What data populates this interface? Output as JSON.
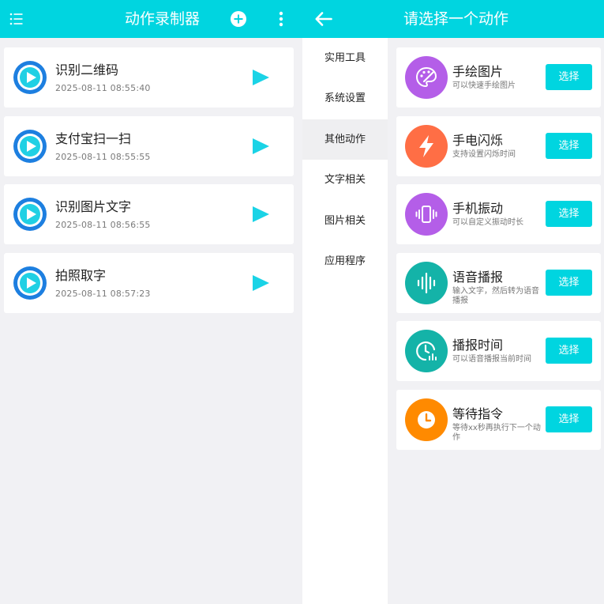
{
  "left": {
    "title": "动作录制器",
    "records": [
      {
        "title": "识别二维码",
        "time": "2025-08-11 08:55:40"
      },
      {
        "title": "支付宝扫一扫",
        "time": "2025-08-11 08:55:55"
      },
      {
        "title": "识别图片文字",
        "time": "2025-08-11 08:56:55"
      },
      {
        "title": "拍照取字",
        "time": "2025-08-11 08:57:23"
      }
    ]
  },
  "right": {
    "title": "请选择一个动作",
    "categories": [
      "实用工具",
      "系统设置",
      "其他动作",
      "文字相关",
      "图片相关",
      "应用程序"
    ],
    "active_category": "其他动作",
    "actions": [
      {
        "title": "手绘图片",
        "desc": "可以快速手绘图片",
        "button": "选择",
        "icon": "paint-palette-icon",
        "color": "#b45ee8"
      },
      {
        "title": "手电闪烁",
        "desc": "支持设置闪烁时间",
        "button": "选择",
        "icon": "lightning-icon",
        "color": "#ff6e45"
      },
      {
        "title": "手机振动",
        "desc": "可以自定义振动时长",
        "button": "选择",
        "icon": "vibrate-icon",
        "color": "#b45ee8"
      },
      {
        "title": "语音播报",
        "desc": "输入文字，然后转为语音播报",
        "button": "选择",
        "icon": "sound-wave-icon",
        "color": "#14b3a8"
      },
      {
        "title": "播报时间",
        "desc": "可以语音播报当前时间",
        "button": "选择",
        "icon": "clock-chart-icon",
        "color": "#14b3a8"
      },
      {
        "title": "等待指令",
        "desc": "等待xx秒再执行下一个动作",
        "button": "选择",
        "icon": "clock-icon",
        "color": "#ff8a00"
      }
    ]
  },
  "colors": {
    "accent": "#00d5e0",
    "record_icon": "#1d7fe0"
  }
}
